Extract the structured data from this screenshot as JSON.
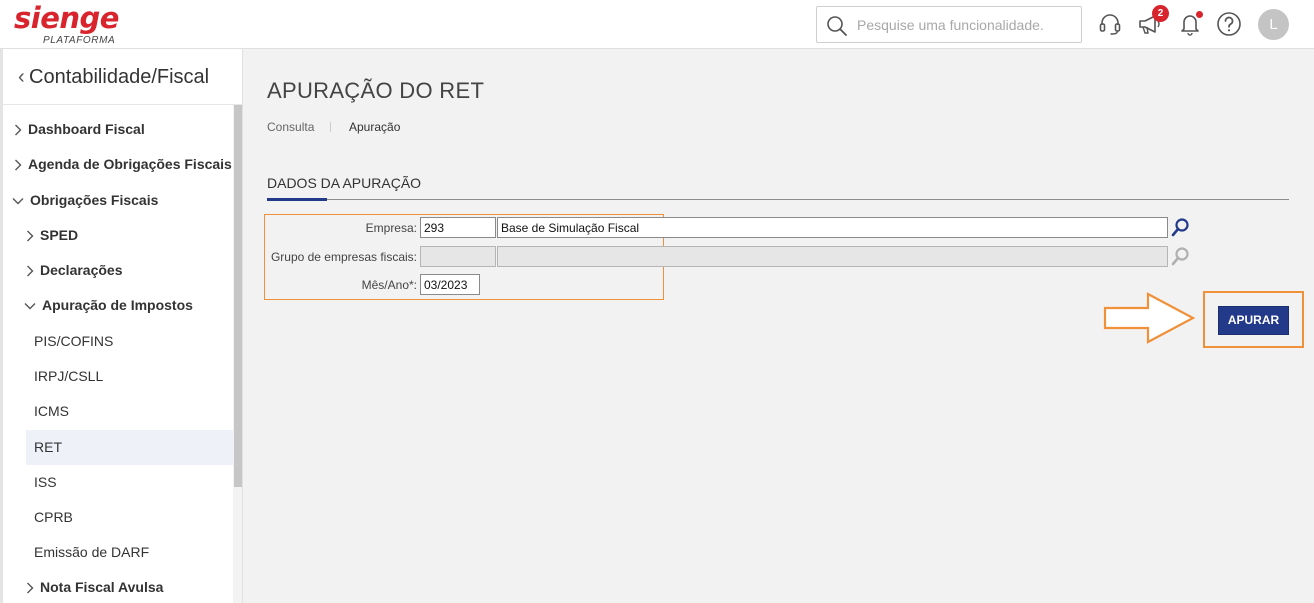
{
  "brand": {
    "logo_word": "sienge",
    "logo_sub": "PLATAFORMA",
    "colors": {
      "brand_red": "#d8242c",
      "primary_blue": "#233a8a",
      "highlight_orange": "#f0913a"
    }
  },
  "header": {
    "search_placeholder": "Pesquise uma funcionalidade.",
    "icons": [
      "search-icon",
      "headset-icon",
      "megaphone-icon",
      "bell-icon",
      "help-icon"
    ],
    "notifications_badge": "2",
    "avatar_initial": "L"
  },
  "sidebar": {
    "title": "Contabilidade/Fiscal",
    "items": [
      {
        "label": "Dashboard Fiscal",
        "chevron": "right"
      },
      {
        "label": "Agenda de Obrigações Fiscais",
        "chevron": "right"
      },
      {
        "label": "Obrigações Fiscais",
        "chevron": "down"
      },
      {
        "label": "SPED",
        "chevron": "right"
      },
      {
        "label": "Declarações",
        "chevron": "right"
      },
      {
        "label": "Apuração de Impostos",
        "chevron": "down"
      },
      {
        "label": "PIS/COFINS"
      },
      {
        "label": "IRPJ/CSLL"
      },
      {
        "label": "ICMS"
      },
      {
        "label": "RET",
        "selected": true
      },
      {
        "label": "ISS"
      },
      {
        "label": "CPRB"
      },
      {
        "label": "Emissão de DARF"
      },
      {
        "label": "Nota Fiscal Avulsa",
        "chevron": "right"
      }
    ]
  },
  "main": {
    "page_title": "APURAÇÃO DO RET",
    "breadcrumb": {
      "first": "Consulta",
      "current": "Apuração"
    },
    "section_title": "DADOS DA APURAÇÃO",
    "form": {
      "empresa_label": "Empresa:",
      "empresa_code": "293",
      "empresa_name": "Base de Simulação Fiscal",
      "grupo_label": "Grupo de empresas fiscais:",
      "grupo_code": "",
      "grupo_name": "",
      "mes_ano_label": "Mês/Ano*:",
      "mes_ano_value": "03/2023"
    },
    "apurar_label": "APURAR"
  }
}
